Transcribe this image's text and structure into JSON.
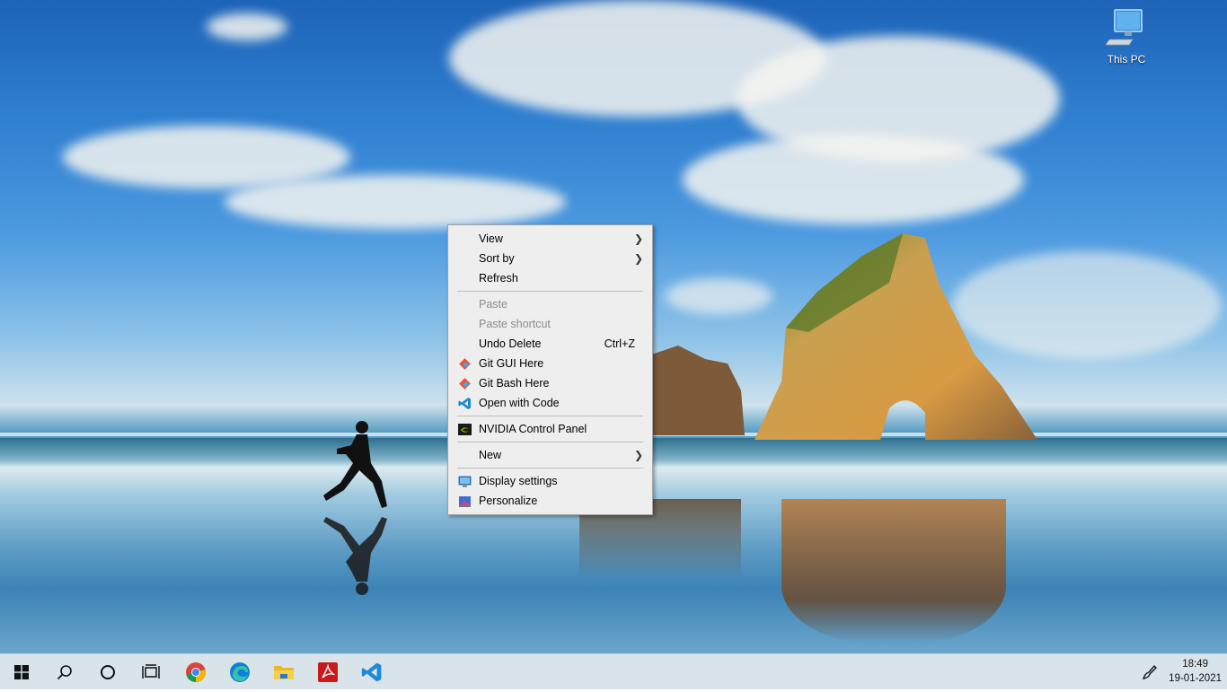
{
  "desktop": {
    "icons": [
      {
        "label": "This PC",
        "icon": "this-pc-icon"
      }
    ]
  },
  "context_menu": {
    "items": [
      {
        "label": "View",
        "submenu": true
      },
      {
        "label": "Sort by",
        "submenu": true
      },
      {
        "label": "Refresh"
      },
      {
        "label": "Paste",
        "disabled": true
      },
      {
        "label": "Paste shortcut",
        "disabled": true
      },
      {
        "label": "Undo Delete",
        "shortcut": "Ctrl+Z"
      },
      {
        "label": "Git GUI Here",
        "icon": "git-gui-icon"
      },
      {
        "label": "Git Bash Here",
        "icon": "git-bash-icon"
      },
      {
        "label": "Open with Code",
        "icon": "vscode-icon"
      },
      {
        "label": "NVIDIA Control Panel",
        "icon": "nvidia-icon"
      },
      {
        "label": "New",
        "submenu": true
      },
      {
        "label": "Display settings",
        "icon": "display-settings-icon"
      },
      {
        "label": "Personalize",
        "icon": "personalize-icon"
      }
    ]
  },
  "taskbar": {
    "buttons": [
      {
        "name": "start-button",
        "icon": "windows-logo-icon"
      },
      {
        "name": "search-button",
        "icon": "search-icon"
      },
      {
        "name": "cortana-button",
        "icon": "cortana-circle-icon"
      },
      {
        "name": "task-view-button",
        "icon": "task-view-icon"
      },
      {
        "name": "chrome-button",
        "icon": "chrome-icon"
      },
      {
        "name": "edge-button",
        "icon": "edge-icon"
      },
      {
        "name": "file-explorer-button",
        "icon": "folder-icon"
      },
      {
        "name": "acrobat-button",
        "icon": "acrobat-icon"
      },
      {
        "name": "vscode-button",
        "icon": "vscode-icon"
      }
    ],
    "clock": {
      "time": "18:49",
      "date": "19-01-2021"
    },
    "tray_icon": "pen-workspace-icon"
  },
  "colors": {
    "menu_bg": "#eeeeee",
    "taskbar_bg": "#d9e4ea",
    "disabled_text": "#8c8c8c"
  }
}
